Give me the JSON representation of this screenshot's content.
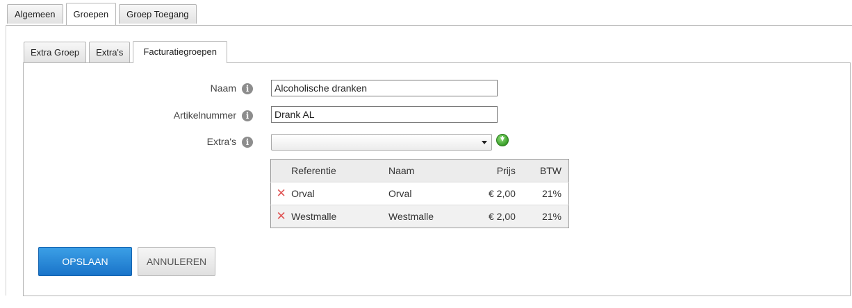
{
  "tabs_outer": [
    {
      "label": "Algemeen"
    },
    {
      "label": "Groepen"
    },
    {
      "label": "Groep Toegang"
    }
  ],
  "tabs_inner": [
    {
      "label": "Extra Groep"
    },
    {
      "label": "Extra's"
    },
    {
      "label": "Facturatiegroepen"
    }
  ],
  "form": {
    "naam_label": "Naam",
    "naam_value": "Alcoholische dranken",
    "artikelnummer_label": "Artikelnummer",
    "artikelnummer_value": "Drank AL",
    "extras_label": "Extra's",
    "extras_selected": "",
    "info_icon": "i",
    "add_icon": "add-circle-green-icon"
  },
  "table": {
    "headers": {
      "referentie": "Referentie",
      "naam": "Naam",
      "prijs": "Prijs",
      "btw": "BTW"
    },
    "rows": [
      {
        "referentie": "Orval",
        "naam": "Orval",
        "prijs": "€ 2,00",
        "btw": "21%"
      },
      {
        "referentie": "Westmalle",
        "naam": "Westmalle",
        "prijs": "€ 2,00",
        "btw": "21%"
      }
    ],
    "delete_glyph": "✕"
  },
  "buttons": {
    "save_label": "OPSLAAN",
    "cancel_label": "ANNULEREN"
  },
  "colors": {
    "primary_button": "#1a74c9",
    "delete_icon": "#e05555",
    "add_icon": "#3a9e2a"
  }
}
